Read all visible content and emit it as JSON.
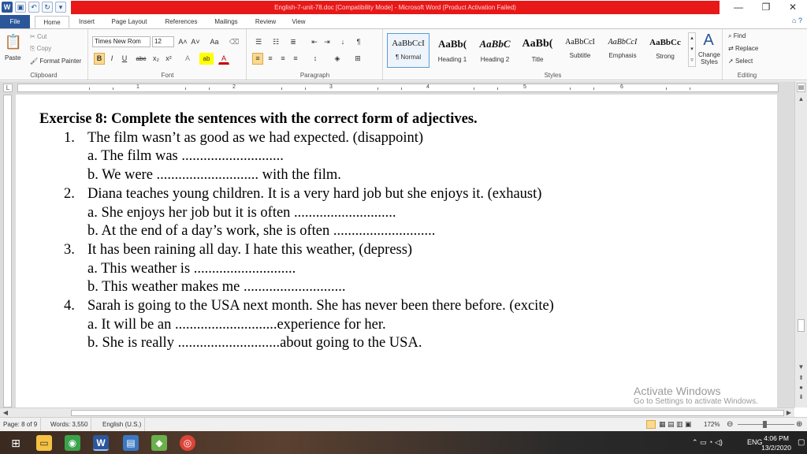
{
  "window": {
    "title": "English-7-unit-78.doc [Compatibility Mode] - Microsoft Word (Product Activation Failed)",
    "controls": {
      "minimize": "—",
      "restore": "❐",
      "close": "✕"
    }
  },
  "tabs": [
    "File",
    "Home",
    "Insert",
    "Page Layout",
    "References",
    "Mailings",
    "Review",
    "View"
  ],
  "ribbon": {
    "clipboard": {
      "paste": "Paste",
      "cut": "Cut",
      "copy": "Copy",
      "format_painter": "Format Painter",
      "label": "Clipboard"
    },
    "font": {
      "font_name": "Times New Rom",
      "font_size": "12",
      "label": "Font",
      "bold": "B",
      "italic": "I",
      "underline": "U",
      "strike": "abc",
      "sub": "x₂",
      "sup": "x²",
      "grow": "A˄",
      "shrink": "A˅",
      "case": "Aa",
      "highlight": "ab",
      "color": "A"
    },
    "paragraph": {
      "label": "Paragraph",
      "pilcrow": "¶"
    },
    "styles": {
      "label": "Styles",
      "items": [
        {
          "sample": "AaBbCcI",
          "name": "¶ Normal"
        },
        {
          "sample": "AaBb(",
          "name": "Heading 1"
        },
        {
          "sample": "AaBbC",
          "name": "Heading 2"
        },
        {
          "sample": "AaBb(",
          "name": "Title"
        },
        {
          "sample": "AaBbCcI",
          "name": "Subtitle"
        },
        {
          "sample": "AaBbCcI",
          "name": "Emphasis"
        },
        {
          "sample": "AaBbCc",
          "name": "Strong"
        }
      ],
      "change_styles": "Change Styles"
    },
    "editing": {
      "find": "Find",
      "replace": "Replace",
      "select": "Select",
      "label": "Editing"
    }
  },
  "ruler": {
    "numbers": [
      "1",
      "2",
      "3",
      "4",
      "5",
      "6"
    ]
  },
  "document": {
    "heading": "Exercise 8: Complete the sentences with the correct form of adjectives.",
    "questions": [
      {
        "num": "1.",
        "text": "The film wasn’t as good as we had expected. (disappoint)",
        "a": "a. The film was ............................",
        "b": "b. We were ............................ with the film."
      },
      {
        "num": "2.",
        "text": "Diana teaches young children. It is a very hard job but she enjoys it. (exhaust)",
        "a": "a. She enjoys her job but it is often ............................",
        "b": "b. At the end of a day’s work, she is often ............................"
      },
      {
        "num": "3.",
        "text": "It has been raining all day. I hate this weather, (depress)",
        "a": "a. This weather is ............................",
        "b": "b. This weather makes me ............................"
      },
      {
        "num": "4.",
        "text": "Sarah is going to the USA next month. She has never been there before. (excite)",
        "a": "a. It will be an ............................experience for her.",
        "b": "b. She is really ............................about going to the USA."
      }
    ]
  },
  "watermark": {
    "line1": "Activate Windows",
    "line2": "Go to Settings to activate Windows."
  },
  "status": {
    "page": "Page: 8 of 9",
    "words": "Words: 3,550",
    "language": "English (U.S.)",
    "zoom": "172%"
  },
  "taskbar": {
    "language": "ENG",
    "time": "4:06 PM",
    "date": "13/2/2020"
  }
}
